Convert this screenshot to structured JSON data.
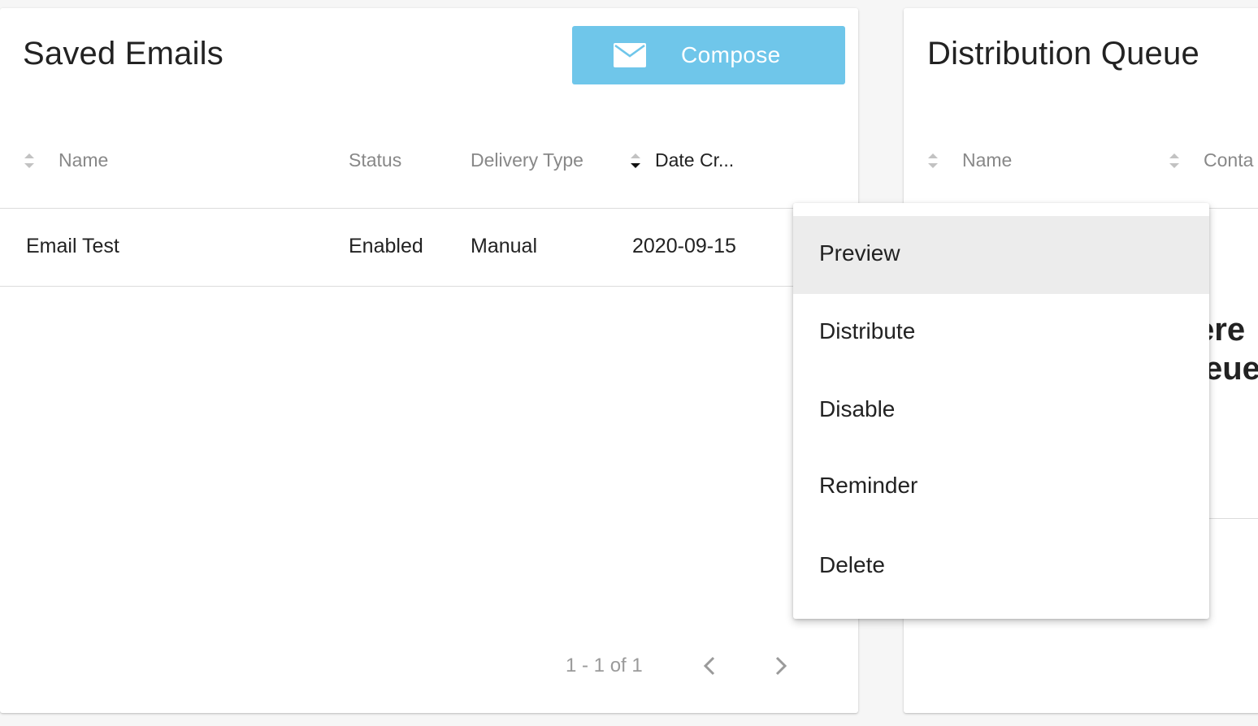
{
  "saved_emails": {
    "title": "Saved Emails",
    "compose_label": "Compose",
    "columns": [
      "Name",
      "Status",
      "Delivery Type",
      "Date Cr..."
    ],
    "rows": [
      {
        "name": "Email Test",
        "status": "Enabled",
        "delivery_type": "Manual",
        "date_created": "2020-09-15"
      }
    ],
    "pagination": {
      "range_text": "1 - 1 of 1"
    }
  },
  "distribution_queue": {
    "title": "Distribution Queue",
    "columns": [
      "Name",
      "Conta"
    ],
    "empty_message_line1": "ere",
    "empty_message_line2": "eue"
  },
  "context_menu": {
    "items": [
      "Preview",
      "Distribute",
      "Disable",
      "Reminder",
      "Delete"
    ],
    "highlighted": "Preview"
  },
  "colors": {
    "accent": "#6fc6ea",
    "highlight": "#ececec",
    "muted_text": "#888888"
  },
  "icons": [
    "mail-icon",
    "sort-icon",
    "sort-desc-icon",
    "chevron-left-icon",
    "chevron-right-icon"
  ]
}
